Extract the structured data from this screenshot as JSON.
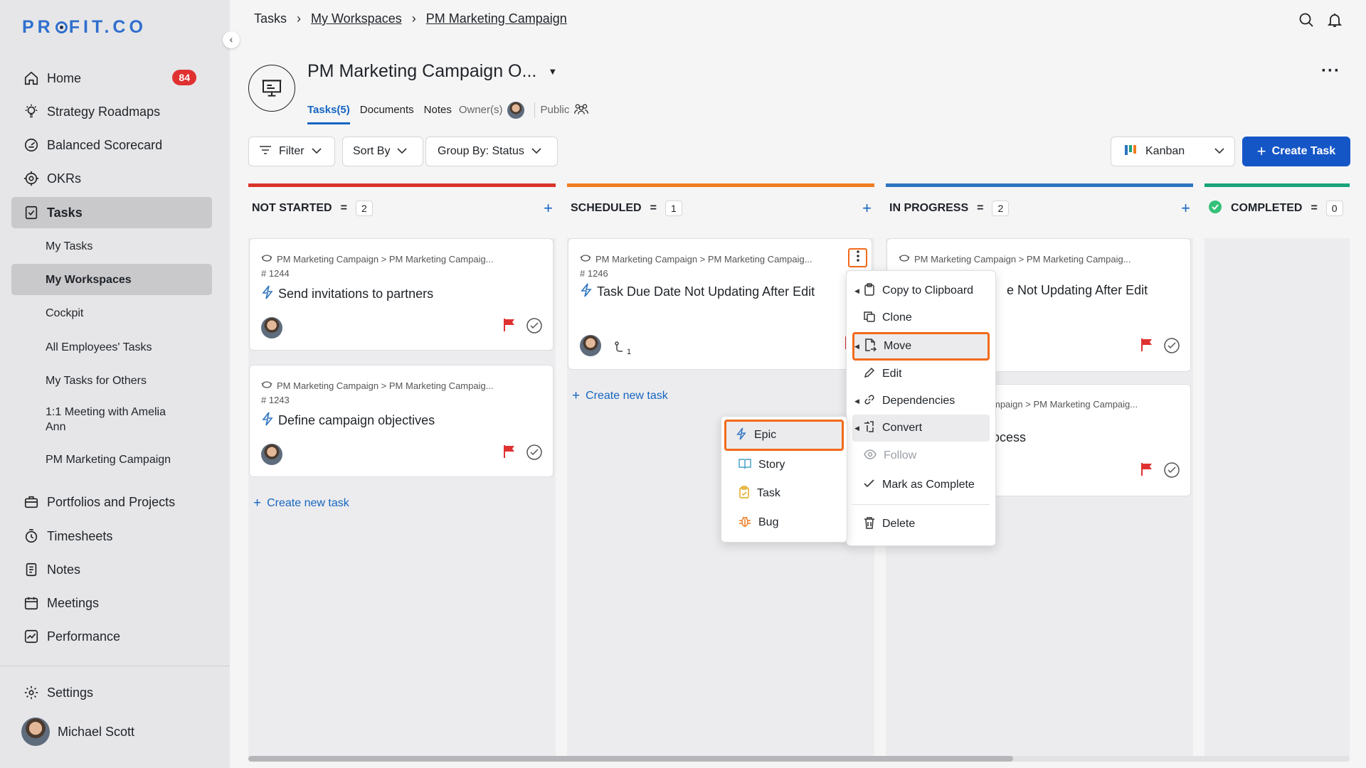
{
  "sidebar": {
    "logo": "PROFIT.CO",
    "items": [
      {
        "label": "Home",
        "badge": "84",
        "icon": "home-icon"
      },
      {
        "label": "Strategy Roadmaps",
        "icon": "bulb-icon"
      },
      {
        "label": "Balanced Scorecard",
        "icon": "scorecard-icon"
      },
      {
        "label": "OKRs",
        "icon": "target-icon"
      },
      {
        "label": "Tasks",
        "icon": "task-icon"
      },
      {
        "label": "Portfolios and Projects",
        "icon": "briefcase-icon"
      },
      {
        "label": "Timesheets",
        "icon": "clock-icon"
      },
      {
        "label": "Notes",
        "icon": "notes-icon"
      },
      {
        "label": "Meetings",
        "icon": "calendar-icon"
      },
      {
        "label": "Performance",
        "icon": "chart-icon"
      }
    ],
    "subitems": [
      "My Tasks",
      "My Workspaces",
      "Cockpit",
      "All Employees' Tasks",
      "My Tasks for Others",
      "1:1 Meeting with Amelia Ann",
      "PM Marketing Campaign"
    ],
    "settings": "Settings",
    "user": "Michael Scott"
  },
  "header": {
    "crumbs": [
      "Tasks",
      "My Workspaces",
      "PM Marketing Campaign"
    ],
    "title": "PM Marketing Campaign O...",
    "tabs": {
      "tasks": "Tasks(5)",
      "documents": "Documents",
      "notes": "Notes",
      "owners": "Owner(s)",
      "visibility": "Public"
    }
  },
  "toolbar": {
    "filter": "Filter",
    "sort": "Sort By",
    "group": "Group By: Status",
    "view": "Kanban",
    "create": "Create Task"
  },
  "columns": [
    {
      "title": "NOT STARTED",
      "count": "2",
      "color": "#d9342b"
    },
    {
      "title": "SCHEDULED",
      "count": "1",
      "color": "#ef7d22"
    },
    {
      "title": "IN PROGRESS",
      "count": "2",
      "color": "#2f74c0"
    },
    {
      "title": "COMPLETED",
      "count": "0",
      "color": "#1aa37a"
    }
  ],
  "cards": {
    "path": "PM Marketing Campaign > PM Marketing Campaig...",
    "c1": {
      "num": "# 1244",
      "title": "Send invitations to partners"
    },
    "c2": {
      "num": "# 1243",
      "title": "Define campaign objectives"
    },
    "c3": {
      "num": "# 1246",
      "title": "Task Due Date Not Updating After Edit",
      "subtasks": "1"
    },
    "c4": {
      "title": "e Not Updating After Edit"
    },
    "c5": {
      "path": "mpaign > PM Marketing Campaig...",
      "title": "ocess"
    }
  },
  "create_new_task": "Create new task",
  "context_menu": [
    "Copy to Clipboard",
    "Clone",
    "Move",
    "Edit",
    "Dependencies",
    "Convert",
    "Follow",
    "Mark as Complete",
    "Delete"
  ],
  "convert_menu": [
    "Epic",
    "Story",
    "Task",
    "Bug"
  ],
  "colors": {
    "accent": "#1556c7",
    "highlight": "#f26a1b",
    "flag": "#e03131"
  }
}
